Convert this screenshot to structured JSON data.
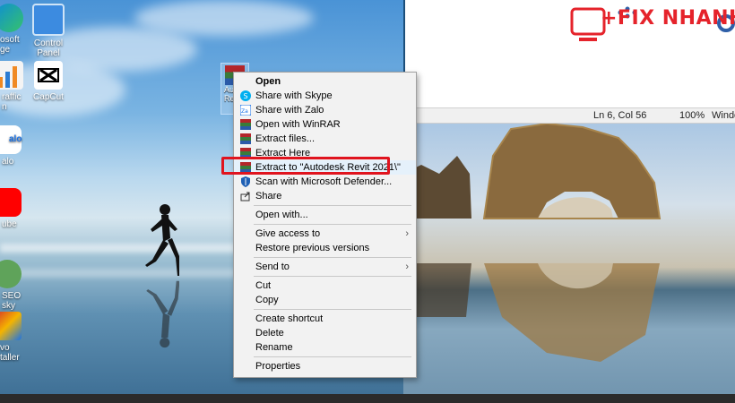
{
  "desktop": {
    "icons": [
      {
        "label": "osoft\nge",
        "name": "edge-shortcut"
      },
      {
        "label": "Control Panel",
        "name": "control-panel"
      },
      {
        "label": "raffic\nn",
        "name": "traffic-app"
      },
      {
        "label": "CapCut",
        "name": "capcut"
      },
      {
        "label": "alo",
        "name": "zalo-app"
      },
      {
        "label": "ube",
        "name": "youtube-app"
      },
      {
        "label": "SEO\nsky",
        "name": "seo-app"
      },
      {
        "label": "vo\ntaller",
        "name": "installer-app"
      }
    ],
    "selected_file_label": "Au\nRe"
  },
  "app_window": {
    "logo_text": "+FIX NHANH",
    "status": {
      "position": "Ln 6, Col 56",
      "zoom": "100%",
      "line_ending": "Windo"
    }
  },
  "context_menu": {
    "items": [
      {
        "label": "Open",
        "icon": "none",
        "bold": true
      },
      {
        "label": "Share with Skype",
        "icon": "skype-icon"
      },
      {
        "label": "Share with Zalo",
        "icon": "zalo-icon"
      },
      {
        "label": "Open with WinRAR",
        "icon": "winrar-icon"
      },
      {
        "label": "Extract files...",
        "icon": "winrar-icon"
      },
      {
        "label": "Extract Here",
        "icon": "winrar-icon"
      },
      {
        "label": "Extract to \"Autodesk Revit 2021\\\"",
        "icon": "winrar-icon"
      },
      {
        "label": "Scan with Microsoft Defender...",
        "icon": "defender-icon"
      },
      {
        "label": "Share",
        "icon": "share-icon"
      },
      {
        "label": "Open with...",
        "icon": "none"
      },
      {
        "label": "Give access to",
        "icon": "none",
        "submenu": true
      },
      {
        "label": "Restore previous versions",
        "icon": "none"
      },
      {
        "label": "Send to",
        "icon": "none",
        "submenu": true
      },
      {
        "label": "Cut",
        "icon": "none"
      },
      {
        "label": "Copy",
        "icon": "none"
      },
      {
        "label": "Create shortcut",
        "icon": "none"
      },
      {
        "label": "Delete",
        "icon": "none"
      },
      {
        "label": "Rename",
        "icon": "none"
      },
      {
        "label": "Properties",
        "icon": "none"
      }
    ],
    "submenu_arrow": "›"
  },
  "colors": {
    "highlight": "#e0141e",
    "menu_bg": "#f2f2f2",
    "logo_red": "#e5232b",
    "logo_blue": "#2f5fa8"
  }
}
